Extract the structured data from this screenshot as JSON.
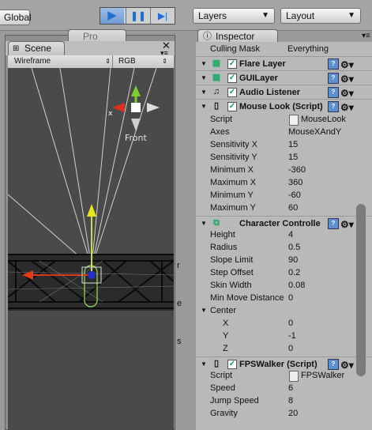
{
  "toolbar": {
    "global_label": "Global",
    "layers_label": "Layers",
    "layout_label": "Layout",
    "play_icon": "▶",
    "pause_icon": "❚❚",
    "step_icon": "▶|"
  },
  "scene": {
    "tab_label": "Scene",
    "render_mode": "Wireframe",
    "color_mode": "RGB",
    "gizmo_label": "Front",
    "gizmo_x": "x",
    "back_tab_label": "Pro"
  },
  "inspector": {
    "tab_label": "Inspector",
    "culling_mask_label": "Culling Mask",
    "culling_mask_value": "Everything",
    "components": [
      {
        "name": "Flare Layer"
      },
      {
        "name": "GUILayer"
      },
      {
        "name": "Audio Listener"
      },
      {
        "name": "Mouse Look (Script)"
      }
    ],
    "mouse_look": [
      {
        "label": "Script",
        "value": "MouseLook"
      },
      {
        "label": "Axes",
        "value": "MouseXAndY"
      },
      {
        "label": "Sensitivity X",
        "value": "15"
      },
      {
        "label": "Sensitivity Y",
        "value": "15"
      },
      {
        "label": "Minimum X",
        "value": "-360"
      },
      {
        "label": "Maximum X",
        "value": "360"
      },
      {
        "label": "Minimum Y",
        "value": "-60"
      },
      {
        "label": "Maximum Y",
        "value": "60"
      }
    ],
    "character_controller": {
      "name": "Character Controlle",
      "fields": [
        {
          "label": "Height",
          "value": "4"
        },
        {
          "label": "Radius",
          "value": "0.5"
        },
        {
          "label": "Slope Limit",
          "value": "90"
        },
        {
          "label": "Step Offset",
          "value": "0.2"
        },
        {
          "label": "Skin Width",
          "value": "0.08"
        },
        {
          "label": "Min Move Distance",
          "value": "0"
        }
      ],
      "center_label": "Center",
      "center": [
        {
          "label": "X",
          "value": "0"
        },
        {
          "label": "Y",
          "value": "-1"
        },
        {
          "label": "Z",
          "value": "0"
        }
      ]
    },
    "fps_walker": {
      "name": "FPSWalker (Script)",
      "fields": [
        {
          "label": "Script",
          "value": "FPSWalker"
        },
        {
          "label": "Speed",
          "value": "6"
        },
        {
          "label": "Jump Speed",
          "value": "8"
        },
        {
          "label": "Gravity",
          "value": "20"
        }
      ]
    }
  },
  "edge_letters": [
    "r",
    "e",
    "s"
  ]
}
